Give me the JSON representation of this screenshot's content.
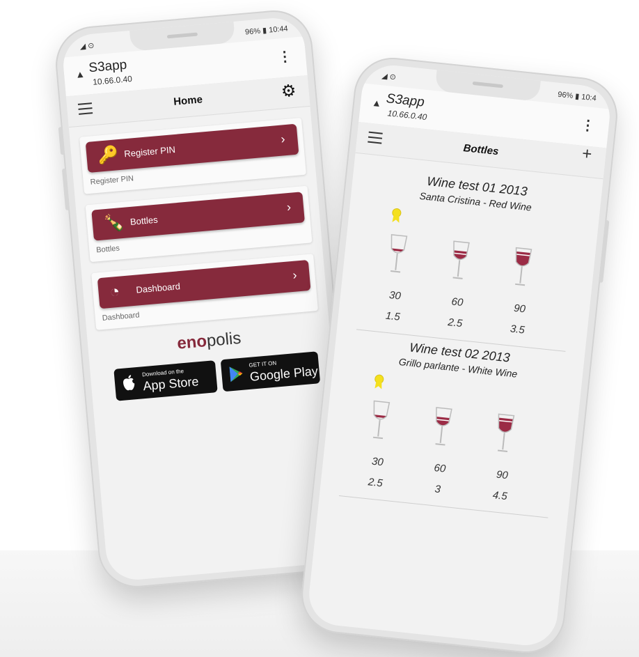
{
  "colors": {
    "brand_red": "#862a3c"
  },
  "phone_left": {
    "status": {
      "left": "◢ ⊙",
      "right": "96% ▮ 10:44"
    },
    "app": {
      "title": "S3app",
      "subtitle": "10.66.0.40",
      "menu_icon": "⋮",
      "warn_icon": "▲"
    },
    "toolbar": {
      "title": "Home",
      "gear_icon": "⚙"
    },
    "menu": [
      {
        "label": "Register PIN",
        "caption": "Register PIN",
        "icon": "key-icon",
        "glyph": "🔑"
      },
      {
        "label": "Bottles",
        "caption": "Bottles",
        "icon": "bottles-icon",
        "glyph": "🍾"
      },
      {
        "label": "Dashboard",
        "caption": "Dashboard",
        "icon": "dashboard-icon",
        "glyph": "◔"
      }
    ],
    "chevron": "›",
    "brand": {
      "part1": "eno",
      "part2": "polis"
    },
    "badges": {
      "appstore": {
        "small": "Download on the",
        "big": "App Store",
        "icon": ""
      },
      "googleplay": {
        "small": "GET IT ON",
        "big": "Google Play",
        "icon": "▶"
      }
    }
  },
  "phone_right": {
    "status": {
      "left": "◢ ⊙",
      "right": "96% ▮ 10:4"
    },
    "app": {
      "title": "S3app",
      "subtitle": "10.66.0.40",
      "menu_icon": "⋮",
      "warn_icon": "▲"
    },
    "toolbar": {
      "title": "Bottles",
      "plus_icon": "+"
    },
    "wines": [
      {
        "title": "Wine test 01 2013",
        "subtitle": "Santa Cristina - Red Wine",
        "glasses": [
          {
            "top": "30",
            "bottom": "1.5",
            "fill": 0.25
          },
          {
            "top": "60",
            "bottom": "2.5",
            "fill": 0.5
          },
          {
            "top": "90",
            "bottom": "3.5",
            "fill": 0.8
          }
        ]
      },
      {
        "title": "Wine test 02 2013",
        "subtitle": "Grillo parlante - White Wine",
        "glasses": [
          {
            "top": "30",
            "bottom": "2.5",
            "fill": 0.25
          },
          {
            "top": "60",
            "bottom": "3",
            "fill": 0.5
          },
          {
            "top": "90",
            "bottom": "4.5",
            "fill": 0.8
          }
        ]
      }
    ]
  }
}
